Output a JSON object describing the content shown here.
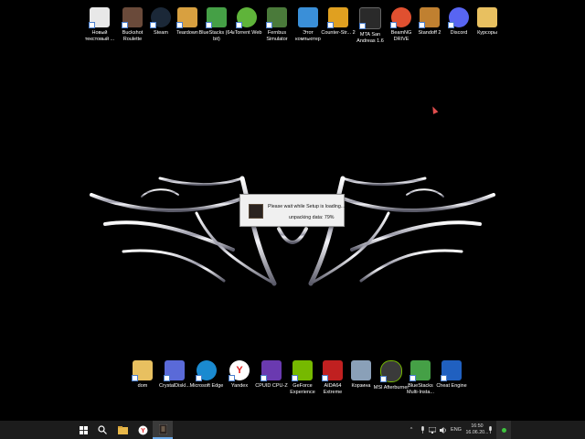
{
  "desktop_icons_top": [
    {
      "label": "Новый текстовый ...",
      "icon": "text-file-icon",
      "color": "#e8e8e8"
    },
    {
      "label": "Buckshot Roulette",
      "icon": "buckshot-roulette-icon",
      "color": "#6a4a3a"
    },
    {
      "label": "Steam",
      "icon": "steam-icon",
      "color": "#1b2838"
    },
    {
      "label": "Teardown",
      "icon": "teardown-icon",
      "color": "#d8a040"
    },
    {
      "label": "BlueStacks (64-bit)",
      "icon": "bluestacks-icon",
      "color": "#45a046"
    },
    {
      "label": "uTorrent Web",
      "icon": "utorrent-icon",
      "color": "#5fb43a"
    },
    {
      "label": "Fernbus Simulator",
      "icon": "fernbus-icon",
      "color": "#4a7a3a"
    },
    {
      "label": "Этот компьютер",
      "icon": "this-pc-icon",
      "color": "#3a8fd8"
    },
    {
      "label": "Counter-Str... 2",
      "icon": "counter-strike-icon",
      "color": "#e0a020"
    },
    {
      "label": "MTA San Andreas 1.6",
      "icon": "mta-icon",
      "color": "#2a2a2a"
    },
    {
      "label": "BeamNG DRIVE",
      "icon": "beamng-icon",
      "color": "#e05030"
    },
    {
      "label": "Standoff 2",
      "icon": "standoff-icon",
      "color": "#c08030"
    },
    {
      "label": "Discord",
      "icon": "discord-icon",
      "color": "#5865f2"
    },
    {
      "label": "Курсоры",
      "icon": "folder-icon",
      "color": "#e8c060"
    }
  ],
  "desktop_icons_bottom": [
    {
      "label": "dom",
      "icon": "folder-icon",
      "color": "#e8c060"
    },
    {
      "label": "CrystalDiskI...",
      "icon": "crystaldisk-icon",
      "color": "#5a6ad8"
    },
    {
      "label": "Microsoft Edge",
      "icon": "edge-icon",
      "color": "#1a8ad0"
    },
    {
      "label": "Yandex",
      "icon": "yandex-icon",
      "color": "#ffffff"
    },
    {
      "label": "CPUID CPU-Z",
      "icon": "cpuz-icon",
      "color": "#6a3ab0"
    },
    {
      "label": "GeForce Experience",
      "icon": "geforce-icon",
      "color": "#76b900"
    },
    {
      "label": "AIDA64 Extreme",
      "icon": "aida64-icon",
      "color": "#c02020"
    },
    {
      "label": "Корзина",
      "icon": "recycle-bin-icon",
      "color": "#8aa0b8"
    },
    {
      "label": "MSI Afterburner",
      "icon": "msi-afterburner-icon",
      "color": "#3a3a3a"
    },
    {
      "label": "BlueStacks Multi-Insta...",
      "icon": "bluestacks-multi-icon",
      "color": "#45a046"
    },
    {
      "label": "Cheat Engine",
      "icon": "cheat-engine-icon",
      "color": "#2060c0"
    }
  ],
  "setup_dialog": {
    "message": "Please wait while Setup is loading...",
    "progress_text": "unpacking data: 79%",
    "progress_percent": 79
  },
  "taskbar": {
    "items": [
      "windows-start-icon",
      "search-icon",
      "file-explorer-icon",
      "yandex-browser-icon",
      "setup-app-icon"
    ],
    "tray": {
      "language": "ENG",
      "time": "16:50",
      "date": "16.06.20..."
    }
  },
  "colors": {
    "taskbar": "#1c1c1c",
    "dialog": "#f0f0f0",
    "accent": "#6aa8e8"
  }
}
